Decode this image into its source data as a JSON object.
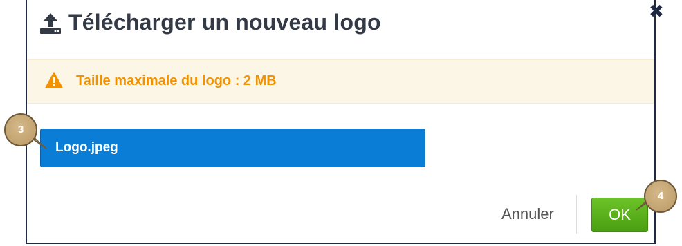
{
  "dialog": {
    "title": "Télécharger un nouveau logo",
    "header_icon": "upload-icon",
    "close_icon": "close-icon",
    "close_glyph": "✖",
    "warning": {
      "icon": "warning-icon",
      "text": "Taille maximale du logo : 2 MB",
      "color": "#f39200"
    },
    "file": {
      "name": "Logo.jpeg",
      "color": "#0a7dd6"
    },
    "footer": {
      "cancel_label": "Annuler",
      "ok_label": "OK",
      "ok_color": "#5ab01c"
    }
  },
  "annotations": {
    "badge_3": "3",
    "badge_4": "4"
  }
}
